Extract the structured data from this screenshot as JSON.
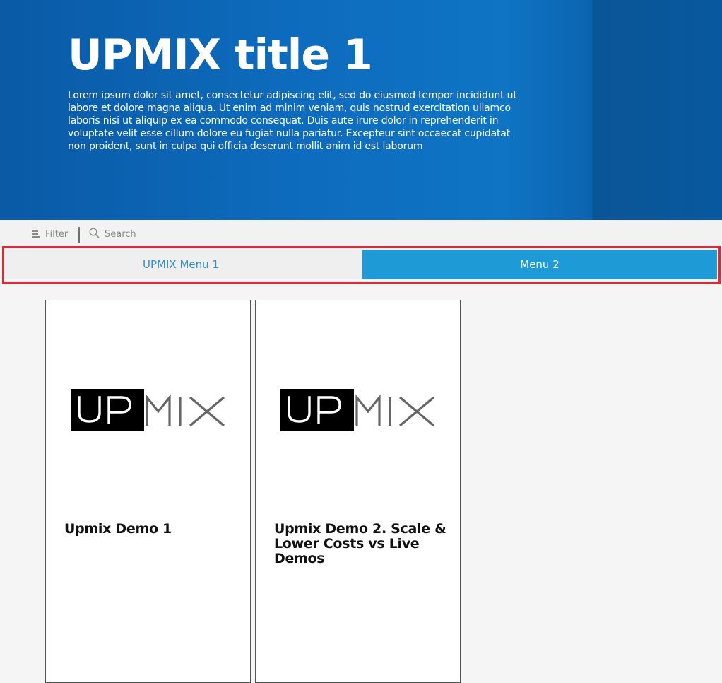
{
  "hero": {
    "title": "UPMIX title 1",
    "description": "Lorem ipsum dolor sit amet, consectetur adipiscing elit, sed do eiusmod tempor incididunt ut labore et dolore magna aliqua. Ut enim ad minim veniam, quis nostrud exercitation ullamco laboris nisi ut aliquip ex ea commodo consequat. Duis aute irure dolor in reprehenderit in voluptate velit esse cillum dolore eu fugiat nulla pariatur. Excepteur sint occaecat cupidatat non proident, sunt in culpa qui officia deserunt mollit anim id est laborum"
  },
  "toolbar": {
    "filter_label": "Filter",
    "search_placeholder": "Search",
    "search_value": ""
  },
  "tabs": [
    {
      "label": "UPMIX Menu 1",
      "active": false
    },
    {
      "label": "Menu 2",
      "active": true
    }
  ],
  "cards": [
    {
      "title": "Upmix Demo 1",
      "logo_text": "UPMIX"
    },
    {
      "title": "Upmix Demo 2. Scale & Lower Costs vs Live Demos",
      "logo_text": "UPMIX"
    }
  ],
  "colors": {
    "hero_blue": "#0d6bbd",
    "tab_active_bg": "#1e9ad6",
    "tab_inactive_text": "#2f8fcf",
    "highlight_border": "#e32636"
  },
  "icons": {
    "filter": "filter-lines-icon",
    "search": "magnifier-icon"
  }
}
